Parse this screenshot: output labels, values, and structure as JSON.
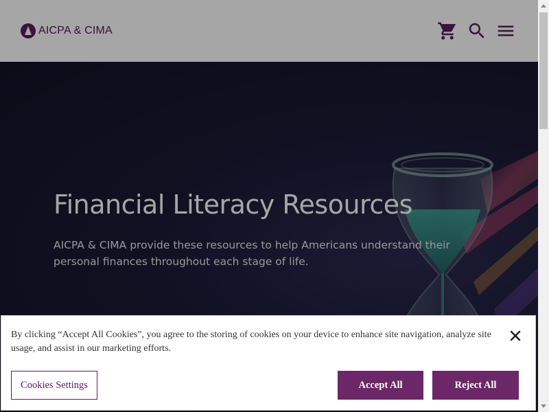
{
  "header": {
    "logo_text": "AICPA & CIMA",
    "icons": [
      "cart-icon",
      "search-icon",
      "menu-icon"
    ]
  },
  "hero": {
    "title": "Financial Literacy Resources",
    "description": "AICPA & CIMA provide these resources to help Americans understand their personal finances throughout each stage of life."
  },
  "cookie_banner": {
    "text": "By clicking “Accept All Cookies”, you agree to the storing of cookies on your device to enhance site navigation, analyze site usage, and assist in our marketing efforts.",
    "settings_label": "Cookies Settings",
    "accept_label": "Accept All",
    "reject_label": "Reject All"
  },
  "colors": {
    "brand": "#5a1e5e",
    "button": "#6b2768",
    "hero_bg": "#1b1a35"
  }
}
